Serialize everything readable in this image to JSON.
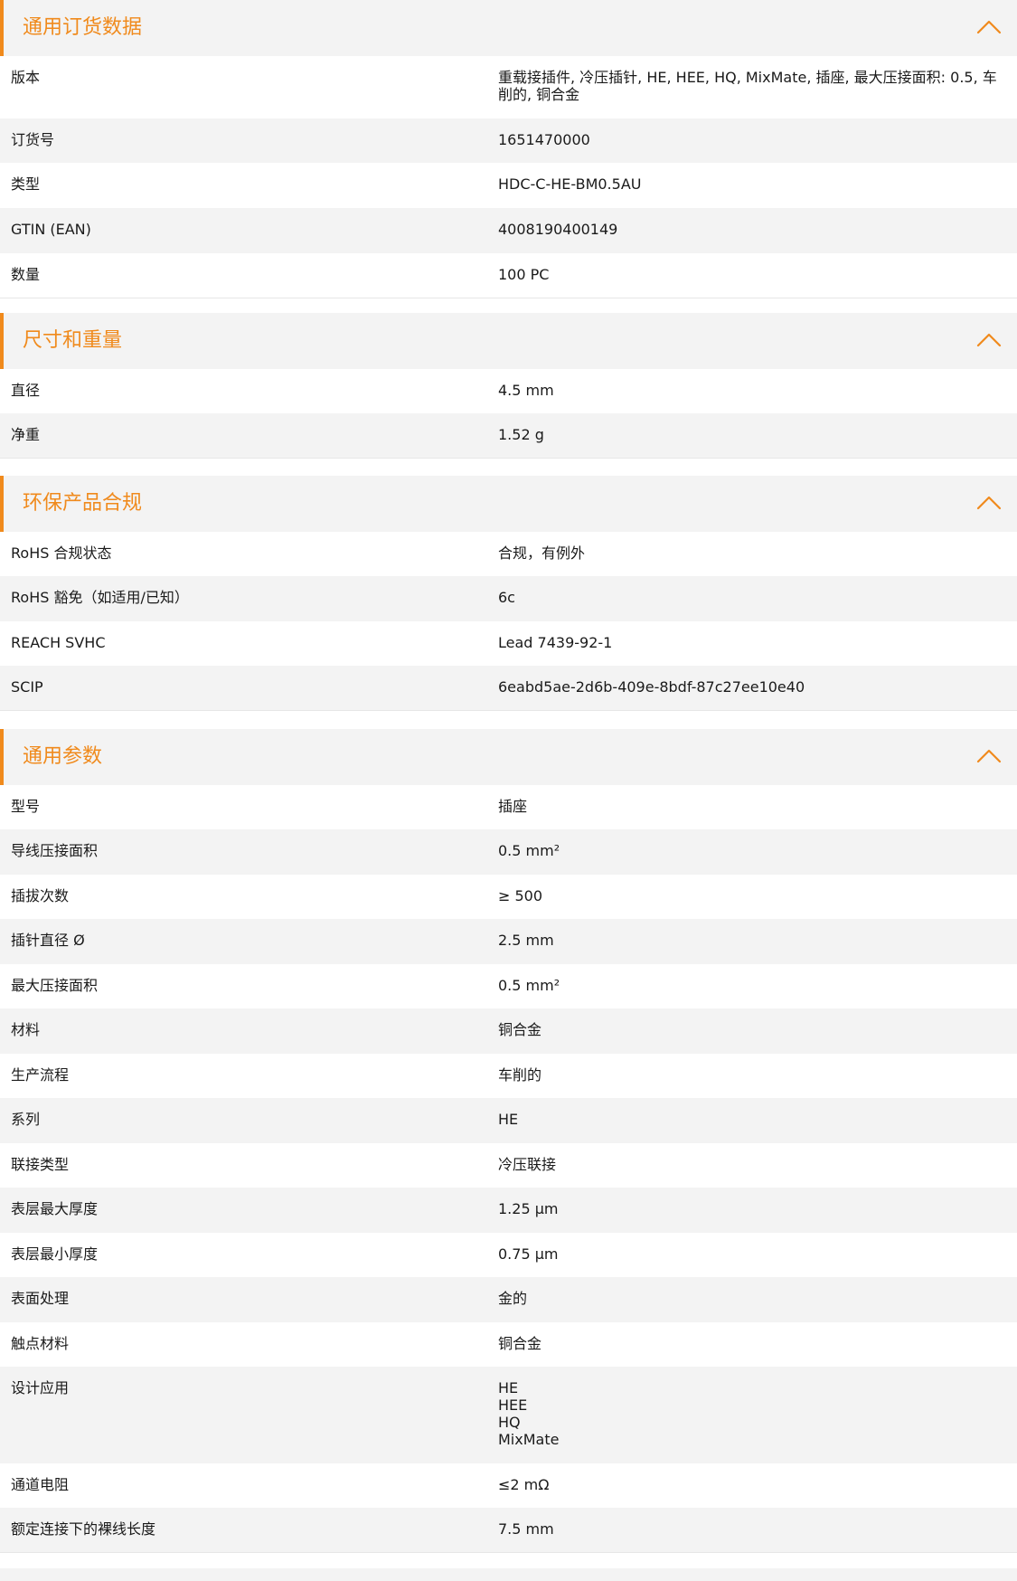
{
  "sections": [
    {
      "title": "通用订货数据",
      "rows": [
        {
          "label": "版本",
          "value": "重载接插件, 冷压插针, HE, HEE, HQ, MixMate, 插座, 最大压接面积: 0.5, 车削的, 铜合金"
        },
        {
          "label": "订货号",
          "value": "1651470000"
        },
        {
          "label": "类型",
          "value": "HDC-C-HE-BM0.5AU"
        },
        {
          "label": "GTIN (EAN)",
          "value": "4008190400149"
        },
        {
          "label": "数量",
          "value": "100  PC"
        }
      ]
    },
    {
      "title": "尺寸和重量",
      "rows": [
        {
          "label": "直径",
          "value": "4.5  mm"
        },
        {
          "label": "净重",
          "value": "1.52  g"
        }
      ]
    },
    {
      "title": "环保产品合规",
      "rows": [
        {
          "label": "RoHS 合规状态",
          "value": "合规，有例外"
        },
        {
          "label": "RoHS 豁免（如适用/已知）",
          "value": "6c"
        },
        {
          "label": "REACH SVHC",
          "value": "Lead 7439-92-1"
        },
        {
          "label": "SCIP",
          "value": "6eabd5ae-2d6b-409e-8bdf-87c27ee10e40"
        }
      ]
    },
    {
      "title": "通用参数",
      "rows": [
        {
          "label": "型号",
          "value": "插座"
        },
        {
          "label": "导线压接面积",
          "value": "0.5 mm²"
        },
        {
          "label": "插拔次数",
          "value": "≥ 500"
        },
        {
          "label": "插针直径 Ø",
          "value": "2.5  mm"
        },
        {
          "label": "最大压接面积",
          "value": "0.5  mm²"
        },
        {
          "label": "材料",
          "value": "铜合金"
        },
        {
          "label": "生产流程",
          "value": "车削的"
        },
        {
          "label": "系列",
          "value": "HE"
        },
        {
          "label": "联接类型",
          "value": "冷压联接"
        },
        {
          "label": "表层最大厚度",
          "value": "1.25  µm"
        },
        {
          "label": "表层最小厚度",
          "value": "0.75  µm"
        },
        {
          "label": "表面处理",
          "value": "金的"
        },
        {
          "label": "触点材料",
          "value": "铜合金"
        },
        {
          "label": "设计应用",
          "value": "HE\nHEE\nHQ\nMixMate"
        },
        {
          "label": "通道电阻",
          "value": "≤2 mΩ"
        },
        {
          "label": "额定连接下的裸线长度",
          "value": "7.5  mm"
        }
      ]
    }
  ],
  "icons": {
    "collapse": "chevron-up-icon"
  },
  "colors": {
    "accent": "#f08a1c",
    "row_alt": "#f3f3f3",
    "text": "#1a1a1a"
  }
}
